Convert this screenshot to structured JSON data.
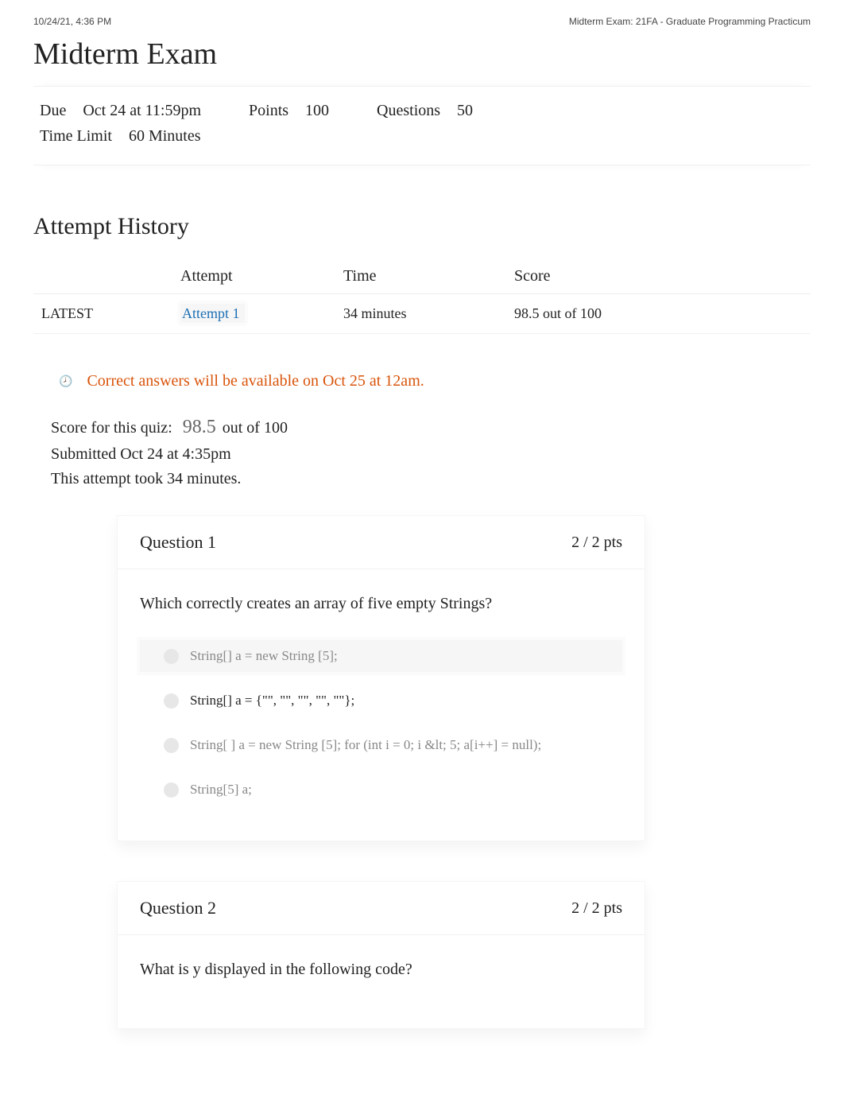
{
  "print_header": {
    "left": "10/24/21, 4:36 PM",
    "right": "Midterm Exam: 21FA - Graduate Programming Practicum"
  },
  "title": "Midterm Exam",
  "meta": {
    "due_label": "Due",
    "due_value": "Oct 24 at 11:59pm",
    "points_label": "Points",
    "points_value": "100",
    "questions_label": "Questions",
    "questions_value": "50",
    "timelimit_label": "Time Limit",
    "timelimit_value": "60 Minutes"
  },
  "history": {
    "heading": "Attempt History",
    "columns": {
      "attempt": "Attempt",
      "time": "Time",
      "score": "Score"
    },
    "rows": [
      {
        "tag": "LATEST",
        "attempt_link": "Attempt 1",
        "time": "34 minutes",
        "score": "98.5 out of 100"
      }
    ]
  },
  "notice_text": "Correct answers will be available on Oct 25 at 12am.",
  "summary": {
    "score_label": "Score for this quiz:",
    "score_value": "98.5",
    "score_suffix": "out of 100",
    "submitted": "Submitted Oct 24 at 4:35pm",
    "duration": "This attempt took 34 minutes."
  },
  "questions": [
    {
      "header": "Question 1",
      "points": "2 / 2 pts",
      "prompt": "Which correctly creates an array of five empty Strings?",
      "answers": [
        {
          "text": "String[] a = new String [5];",
          "selected": false
        },
        {
          "text": "String[] a = {\"\", \"\", \"\", \"\", \"\"};",
          "selected": true
        },
        {
          "text": "String[ ] a = new String [5]; for (int i = 0; i &lt; 5; a[i++] = null);",
          "selected": false
        },
        {
          "text": "String[5] a;",
          "selected": false
        }
      ]
    },
    {
      "header": "Question 2",
      "points": "2 / 2 pts",
      "prompt": "What is y displayed in the following code?",
      "answers": []
    }
  ]
}
